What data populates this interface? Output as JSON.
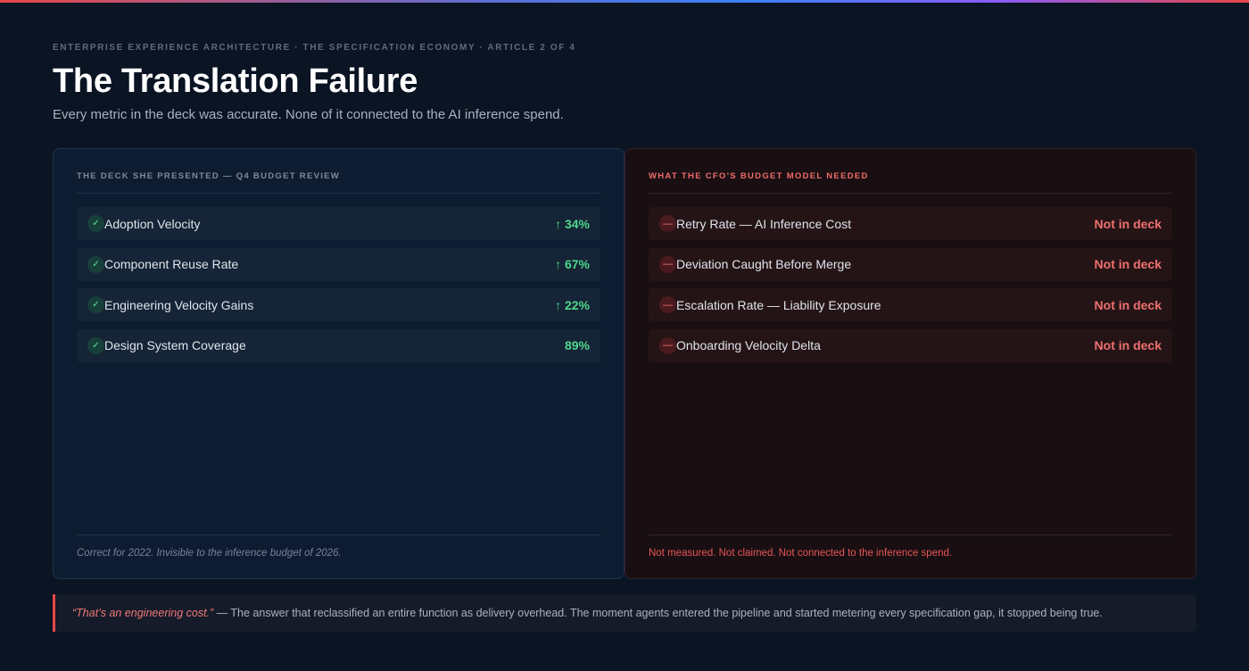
{
  "header": {
    "eyebrow": "ENTERPRISE EXPERIENCE ARCHITECTURE · THE SPECIFICATION ECONOMY · ARTICLE 2 OF 4",
    "title": "The Translation Failure",
    "subtitle": "Every metric in the deck was accurate. None of it connected to the AI inference spend."
  },
  "left": {
    "heading": "THE DECK SHE PRESENTED — Q4 BUDGET REVIEW",
    "items": [
      {
        "icon": "✓",
        "label": "Adoption Velocity",
        "value": "↑ 34%"
      },
      {
        "icon": "✓",
        "label": "Component Reuse Rate",
        "value": "↑ 67%"
      },
      {
        "icon": "✓",
        "label": "Engineering Velocity Gains",
        "value": "↑ 22%"
      },
      {
        "icon": "✓",
        "label": "Design System Coverage",
        "value": "89%"
      }
    ],
    "footer": "Correct for 2022. Invisible to the inference budget of 2026."
  },
  "right": {
    "heading": "WHAT THE CFO'S BUDGET MODEL NEEDED",
    "items": [
      {
        "icon": "—",
        "label": "Retry Rate — AI Inference Cost",
        "value": "Not in deck"
      },
      {
        "icon": "—",
        "label": "Deviation Caught Before Merge",
        "value": "Not in deck"
      },
      {
        "icon": "—",
        "label": "Escalation Rate — Liability Exposure",
        "value": "Not in deck"
      },
      {
        "icon": "—",
        "label": "Onboarding Velocity Delta",
        "value": "Not in deck"
      }
    ],
    "footer": "Not measured. Not claimed. Not connected to the inference spend."
  },
  "quote": {
    "quote_text": "“That’s an engineering cost.”",
    "rest_text": " — The answer that reclassified an entire function as delivery overhead. The moment agents entered the pipeline and started metering every specification gap, it stopped being true."
  },
  "colors": {
    "accent_red": "#e84747",
    "positive_green": "#4fd68c",
    "background": "#0a1423"
  },
  "icons": {
    "ok": "check-icon",
    "missing": "dash-icon"
  }
}
